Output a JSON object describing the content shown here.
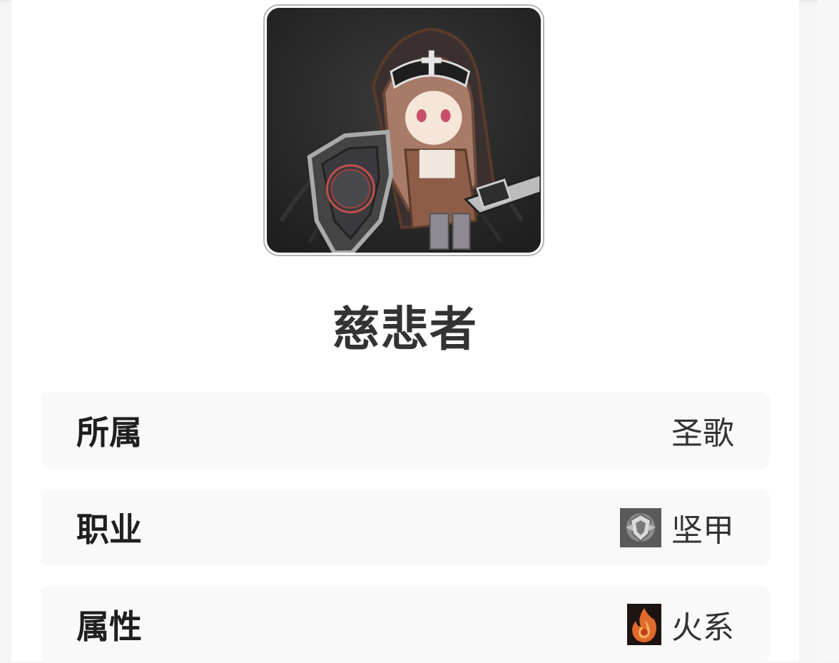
{
  "character": {
    "name": "慈悲者",
    "portrait_icon": "nun-knight-with-shield-portrait"
  },
  "info_rows": [
    {
      "label": "所属",
      "value": "圣歌",
      "icon": ""
    },
    {
      "label": "职业",
      "value": "坚甲",
      "icon": "shield-class-icon"
    },
    {
      "label": "属性",
      "value": "火系",
      "icon": "fire-element-icon"
    }
  ],
  "colors": {
    "card_bg": "#ffffff",
    "row_bg": "#f9f9f9",
    "label": "#1f1f1f",
    "value": "#333333",
    "frame_border": "#b5b5b5"
  }
}
